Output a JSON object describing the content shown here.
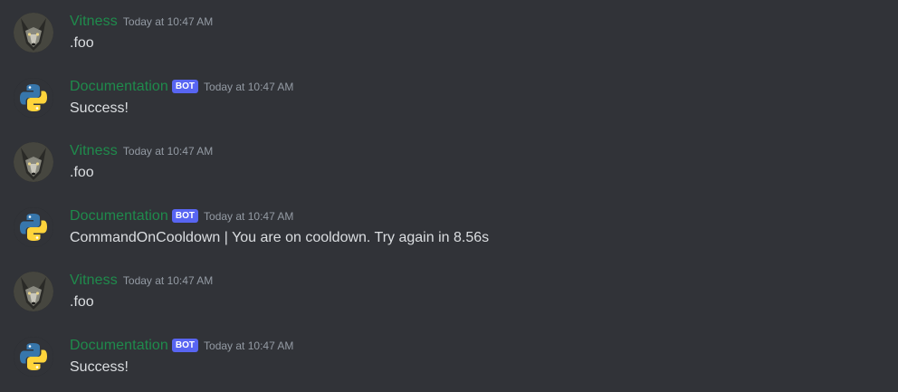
{
  "messages": [
    {
      "author": "Vitness",
      "is_bot": false,
      "timestamp": "Today at 10:47 AM",
      "text": ".foo",
      "avatar": "wolf-avatar"
    },
    {
      "author": "Documentation",
      "is_bot": true,
      "bot_tag": "BOT",
      "timestamp": "Today at 10:47 AM",
      "text": "Success!",
      "avatar": "python-logo-avatar"
    },
    {
      "author": "Vitness",
      "is_bot": false,
      "timestamp": "Today at 10:47 AM",
      "text": ".foo",
      "avatar": "wolf-avatar"
    },
    {
      "author": "Documentation",
      "is_bot": true,
      "bot_tag": "BOT",
      "timestamp": "Today at 10:47 AM",
      "text": "CommandOnCooldown | You are on cooldown. Try again in 8.56s",
      "avatar": "python-logo-avatar"
    },
    {
      "author": "Vitness",
      "is_bot": false,
      "timestamp": "Today at 10:47 AM",
      "text": ".foo",
      "avatar": "wolf-avatar"
    },
    {
      "author": "Documentation",
      "is_bot": true,
      "bot_tag": "BOT",
      "timestamp": "Today at 10:47 AM",
      "text": "Success!",
      "avatar": "python-logo-avatar"
    }
  ],
  "colors": {
    "background": "#313338",
    "username": "#1f8b4c",
    "bot_tag": "#5865f2",
    "timestamp": "#949ba4",
    "message_text": "#dbdee1"
  }
}
